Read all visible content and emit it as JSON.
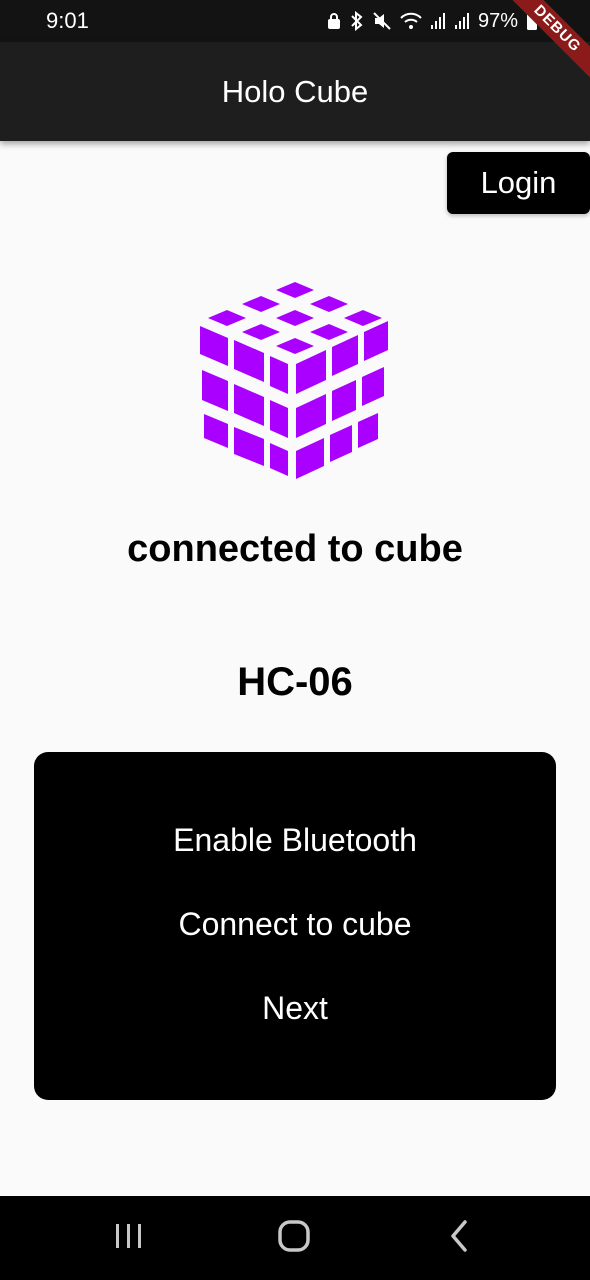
{
  "status_bar": {
    "time": "9:01",
    "battery": "97%",
    "icons": [
      "lock-icon",
      "bluetooth-icon",
      "mute-icon",
      "wifi-icon",
      "signal-icon",
      "signal-icon",
      "battery-icon"
    ]
  },
  "debug_banner": "DEBUG",
  "app_bar": {
    "title": "Holo Cube"
  },
  "login_button": "Login",
  "logo": {
    "icon": "rubiks-cube-icon",
    "color": "#aa00ff"
  },
  "connection_status": "connected to cube",
  "device_name": "HC-06",
  "actions": {
    "enable_bluetooth": "Enable Bluetooth",
    "connect": "Connect to cube",
    "next": "Next"
  },
  "nav_bar": {
    "icons": [
      "recents-icon",
      "home-icon",
      "back-icon"
    ]
  }
}
